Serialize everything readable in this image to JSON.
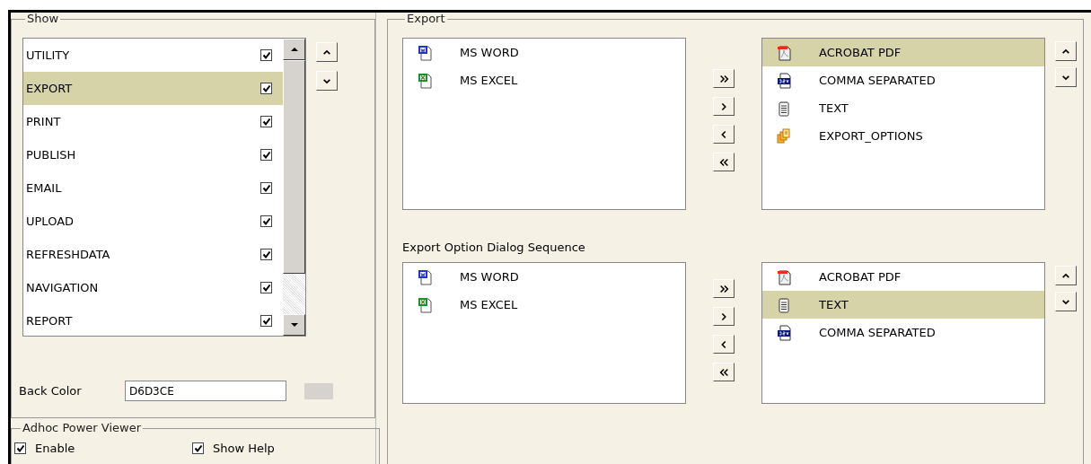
{
  "show": {
    "title": "Show",
    "items": [
      {
        "label": "UTILITY",
        "checked": true,
        "selected": false
      },
      {
        "label": "EXPORT",
        "checked": true,
        "selected": true
      },
      {
        "label": "PRINT",
        "checked": true,
        "selected": false
      },
      {
        "label": "PUBLISH",
        "checked": true,
        "selected": false
      },
      {
        "label": "EMAIL",
        "checked": true,
        "selected": false
      },
      {
        "label": "UPLOAD",
        "checked": true,
        "selected": false
      },
      {
        "label": "REFRESHDATA",
        "checked": true,
        "selected": false
      },
      {
        "label": "NAVIGATION",
        "checked": true,
        "selected": false
      },
      {
        "label": "REPORT",
        "checked": true,
        "selected": false
      }
    ],
    "back_color": {
      "label": "Back Color",
      "value": "D6D3CE"
    }
  },
  "adhoc": {
    "title": "Adhoc Power Viewer",
    "options": [
      {
        "label": "Enable",
        "checked": true
      },
      {
        "label": "Show Help",
        "checked": true
      }
    ]
  },
  "export": {
    "title": "Export",
    "available": [
      {
        "label": "MS WORD",
        "kind": "word",
        "selected": false
      },
      {
        "label": "MS EXCEL",
        "kind": "excel",
        "selected": false
      }
    ],
    "chosen": [
      {
        "label": "ACROBAT PDF",
        "kind": "pdf",
        "selected": true
      },
      {
        "label": "COMMA SEPARATED",
        "kind": "csv",
        "selected": false
      },
      {
        "label": "TEXT",
        "kind": "text",
        "selected": false
      },
      {
        "label": "EXPORT_OPTIONS",
        "kind": "options",
        "selected": false
      }
    ]
  },
  "sequence": {
    "title": "Export Option Dialog Sequence",
    "available": [
      {
        "label": "MS WORD",
        "kind": "word",
        "selected": false
      },
      {
        "label": "MS EXCEL",
        "kind": "excel",
        "selected": false
      }
    ],
    "chosen": [
      {
        "label": "ACROBAT PDF",
        "kind": "pdf",
        "selected": false
      },
      {
        "label": "TEXT",
        "kind": "text",
        "selected": true
      },
      {
        "label": "COMMA SEPARATED",
        "kind": "csv",
        "selected": false
      }
    ]
  }
}
